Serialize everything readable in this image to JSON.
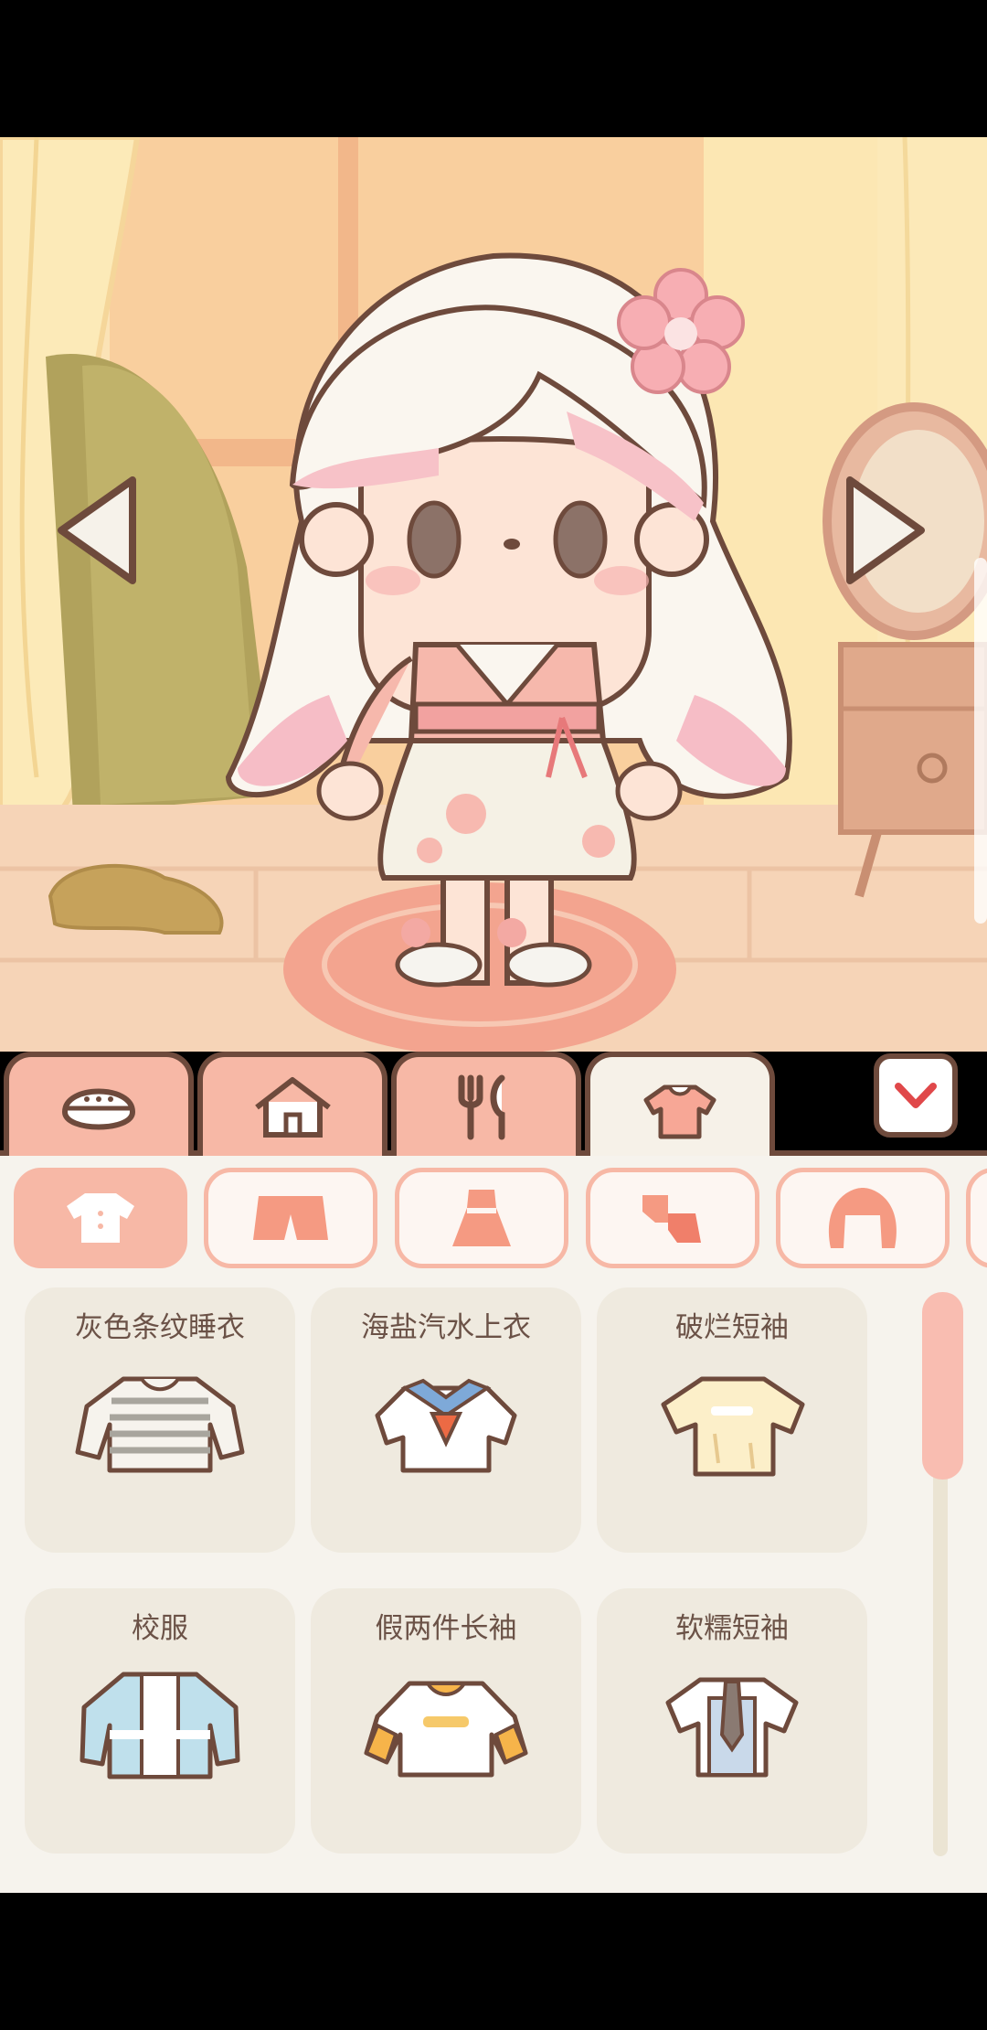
{
  "navigation": {
    "prev_icon": "triangle-left",
    "next_icon": "triangle-right"
  },
  "tabs": [
    {
      "name": "face",
      "icon": "face-icon",
      "active": false
    },
    {
      "name": "home",
      "icon": "house-icon",
      "active": false
    },
    {
      "name": "food",
      "icon": "fork-spoon-icon",
      "active": false
    },
    {
      "name": "clothes",
      "icon": "shirt-icon",
      "active": true
    }
  ],
  "collapse_icon": "chevron-down-icon",
  "categories": [
    {
      "name": "tops",
      "icon": "shirt-icon",
      "active": true
    },
    {
      "name": "bottoms",
      "icon": "shorts-icon",
      "active": false
    },
    {
      "name": "dresses",
      "icon": "dress-icon",
      "active": false
    },
    {
      "name": "socks",
      "icon": "socks-icon",
      "active": false
    },
    {
      "name": "hair",
      "icon": "hair-icon",
      "active": false
    }
  ],
  "items": [
    {
      "label": "灰色条纹睡衣",
      "icon": "striped-pajama-icon"
    },
    {
      "label": "海盐汽水上衣",
      "icon": "sailor-top-icon"
    },
    {
      "label": "破烂短袖",
      "icon": "ragged-tee-icon"
    },
    {
      "label": "校服",
      "icon": "school-uniform-icon"
    },
    {
      "label": "假两件长袖",
      "icon": "layered-longsleeve-icon"
    },
    {
      "label": "软糯短袖",
      "icon": "tie-shirt-icon"
    }
  ],
  "colors": {
    "accent": "#f7b8a6",
    "outline": "#6e4a3c",
    "panel_bg": "#f6f3ed",
    "card_bg": "#efeadf",
    "text": "#6b5247"
  }
}
